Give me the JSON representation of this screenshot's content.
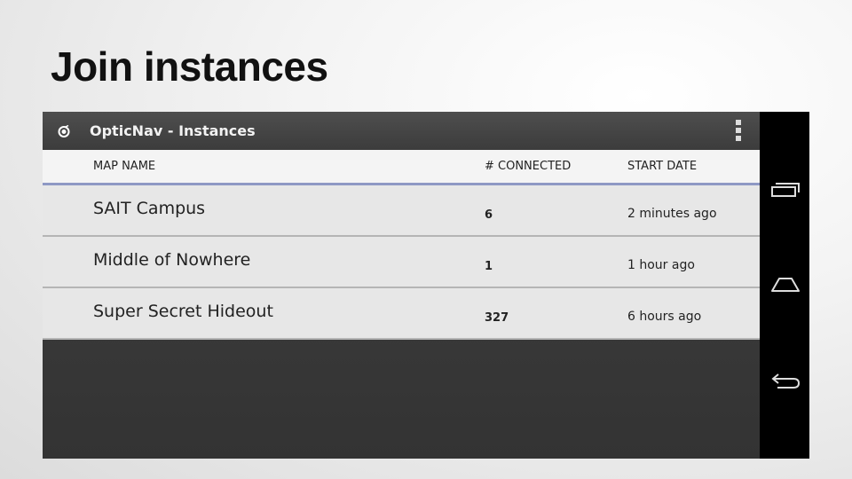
{
  "slide": {
    "title": "Join instances"
  },
  "app": {
    "title": "OpticNav - Instances",
    "icon": "opticnav-logo-icon",
    "overflow_icon": "overflow-menu-icon"
  },
  "table": {
    "headers": {
      "name": "MAP NAME",
      "connected": "# CONNECTED",
      "start_date": "START DATE"
    },
    "rows": [
      {
        "name": "SAIT Campus",
        "connected": "6",
        "start_date": "2 minutes ago"
      },
      {
        "name": "Middle of Nowhere",
        "connected": "1",
        "start_date": "1 hour ago"
      },
      {
        "name": "Super Secret Hideout",
        "connected": "327",
        "start_date": "6 hours ago"
      }
    ]
  },
  "navbar": {
    "buttons": [
      "recent-apps-icon",
      "home-icon",
      "back-icon"
    ]
  },
  "colors": {
    "actionbar": "#444444",
    "header_underline": "#8e98c4",
    "row_bg": "#e7e7e7",
    "navbar": "#000000"
  }
}
